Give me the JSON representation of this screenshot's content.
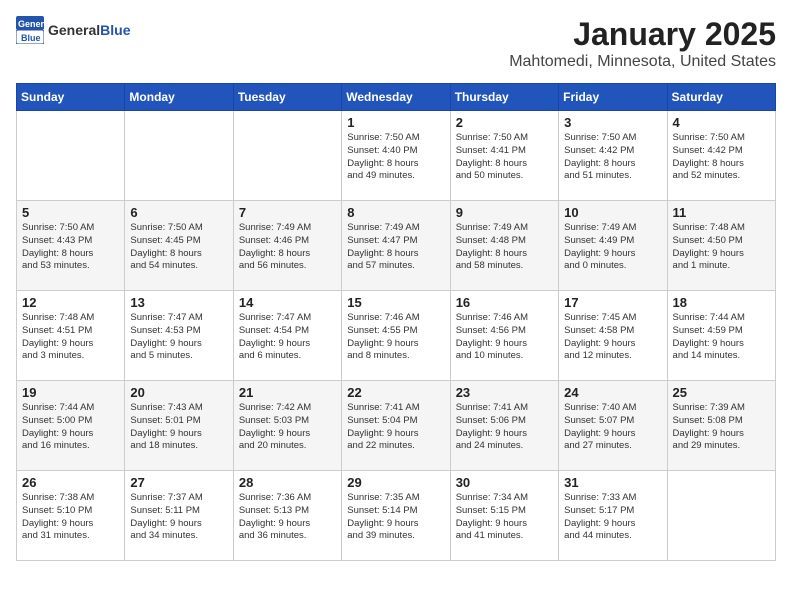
{
  "header": {
    "logo_general": "General",
    "logo_blue": "Blue",
    "month": "January 2025",
    "location": "Mahtomedi, Minnesota, United States"
  },
  "weekdays": [
    "Sunday",
    "Monday",
    "Tuesday",
    "Wednesday",
    "Thursday",
    "Friday",
    "Saturday"
  ],
  "weeks": [
    [
      {
        "day": "",
        "info": ""
      },
      {
        "day": "",
        "info": ""
      },
      {
        "day": "",
        "info": ""
      },
      {
        "day": "1",
        "info": "Sunrise: 7:50 AM\nSunset: 4:40 PM\nDaylight: 8 hours\nand 49 minutes."
      },
      {
        "day": "2",
        "info": "Sunrise: 7:50 AM\nSunset: 4:41 PM\nDaylight: 8 hours\nand 50 minutes."
      },
      {
        "day": "3",
        "info": "Sunrise: 7:50 AM\nSunset: 4:42 PM\nDaylight: 8 hours\nand 51 minutes."
      },
      {
        "day": "4",
        "info": "Sunrise: 7:50 AM\nSunset: 4:42 PM\nDaylight: 8 hours\nand 52 minutes."
      }
    ],
    [
      {
        "day": "5",
        "info": "Sunrise: 7:50 AM\nSunset: 4:43 PM\nDaylight: 8 hours\nand 53 minutes."
      },
      {
        "day": "6",
        "info": "Sunrise: 7:50 AM\nSunset: 4:45 PM\nDaylight: 8 hours\nand 54 minutes."
      },
      {
        "day": "7",
        "info": "Sunrise: 7:49 AM\nSunset: 4:46 PM\nDaylight: 8 hours\nand 56 minutes."
      },
      {
        "day": "8",
        "info": "Sunrise: 7:49 AM\nSunset: 4:47 PM\nDaylight: 8 hours\nand 57 minutes."
      },
      {
        "day": "9",
        "info": "Sunrise: 7:49 AM\nSunset: 4:48 PM\nDaylight: 8 hours\nand 58 minutes."
      },
      {
        "day": "10",
        "info": "Sunrise: 7:49 AM\nSunset: 4:49 PM\nDaylight: 9 hours\nand 0 minutes."
      },
      {
        "day": "11",
        "info": "Sunrise: 7:48 AM\nSunset: 4:50 PM\nDaylight: 9 hours\nand 1 minute."
      }
    ],
    [
      {
        "day": "12",
        "info": "Sunrise: 7:48 AM\nSunset: 4:51 PM\nDaylight: 9 hours\nand 3 minutes."
      },
      {
        "day": "13",
        "info": "Sunrise: 7:47 AM\nSunset: 4:53 PM\nDaylight: 9 hours\nand 5 minutes."
      },
      {
        "day": "14",
        "info": "Sunrise: 7:47 AM\nSunset: 4:54 PM\nDaylight: 9 hours\nand 6 minutes."
      },
      {
        "day": "15",
        "info": "Sunrise: 7:46 AM\nSunset: 4:55 PM\nDaylight: 9 hours\nand 8 minutes."
      },
      {
        "day": "16",
        "info": "Sunrise: 7:46 AM\nSunset: 4:56 PM\nDaylight: 9 hours\nand 10 minutes."
      },
      {
        "day": "17",
        "info": "Sunrise: 7:45 AM\nSunset: 4:58 PM\nDaylight: 9 hours\nand 12 minutes."
      },
      {
        "day": "18",
        "info": "Sunrise: 7:44 AM\nSunset: 4:59 PM\nDaylight: 9 hours\nand 14 minutes."
      }
    ],
    [
      {
        "day": "19",
        "info": "Sunrise: 7:44 AM\nSunset: 5:00 PM\nDaylight: 9 hours\nand 16 minutes."
      },
      {
        "day": "20",
        "info": "Sunrise: 7:43 AM\nSunset: 5:01 PM\nDaylight: 9 hours\nand 18 minutes."
      },
      {
        "day": "21",
        "info": "Sunrise: 7:42 AM\nSunset: 5:03 PM\nDaylight: 9 hours\nand 20 minutes."
      },
      {
        "day": "22",
        "info": "Sunrise: 7:41 AM\nSunset: 5:04 PM\nDaylight: 9 hours\nand 22 minutes."
      },
      {
        "day": "23",
        "info": "Sunrise: 7:41 AM\nSunset: 5:06 PM\nDaylight: 9 hours\nand 24 minutes."
      },
      {
        "day": "24",
        "info": "Sunrise: 7:40 AM\nSunset: 5:07 PM\nDaylight: 9 hours\nand 27 minutes."
      },
      {
        "day": "25",
        "info": "Sunrise: 7:39 AM\nSunset: 5:08 PM\nDaylight: 9 hours\nand 29 minutes."
      }
    ],
    [
      {
        "day": "26",
        "info": "Sunrise: 7:38 AM\nSunset: 5:10 PM\nDaylight: 9 hours\nand 31 minutes."
      },
      {
        "day": "27",
        "info": "Sunrise: 7:37 AM\nSunset: 5:11 PM\nDaylight: 9 hours\nand 34 minutes."
      },
      {
        "day": "28",
        "info": "Sunrise: 7:36 AM\nSunset: 5:13 PM\nDaylight: 9 hours\nand 36 minutes."
      },
      {
        "day": "29",
        "info": "Sunrise: 7:35 AM\nSunset: 5:14 PM\nDaylight: 9 hours\nand 39 minutes."
      },
      {
        "day": "30",
        "info": "Sunrise: 7:34 AM\nSunset: 5:15 PM\nDaylight: 9 hours\nand 41 minutes."
      },
      {
        "day": "31",
        "info": "Sunrise: 7:33 AM\nSunset: 5:17 PM\nDaylight: 9 hours\nand 44 minutes."
      },
      {
        "day": "",
        "info": ""
      }
    ]
  ]
}
